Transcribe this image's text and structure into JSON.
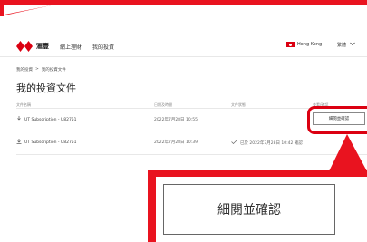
{
  "header": {
    "bank_name": "滙豐",
    "nav": {
      "online_banking": "網上理財",
      "investment": "我的投資"
    },
    "region": "Hong Kong",
    "language": "繁體",
    "language_chevron": "chevron-down-icon"
  },
  "breadcrumb": {
    "home": "我的投資",
    "separator": ">",
    "current": "我的投資文件"
  },
  "page_title": "我的投資文件",
  "table": {
    "headers": [
      "文件名稱",
      "日期及時間",
      "文件狀態",
      "查看/確認"
    ],
    "rows": [
      {
        "name": "UT Subscription - U82751",
        "date": "2022年7月28日 10:55",
        "status": "",
        "action": "細閱並確認"
      },
      {
        "name": "UT Subscription - U82751",
        "date": "2022年7月28日 10:39",
        "status": "已於 2022年7月28日 10:42 確認",
        "action": ""
      }
    ]
  },
  "callout": {
    "button_label": "細閱並確認"
  },
  "colors": {
    "brand_red": "#db0011",
    "highlight_red": "#e9131f"
  }
}
